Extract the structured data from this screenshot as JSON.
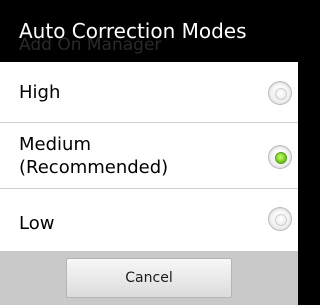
{
  "dialog": {
    "title": "Auto Correction Modes",
    "ghost_title": "Add On Manager"
  },
  "options": [
    {
      "label": "High",
      "selected": false
    },
    {
      "label": "Medium\n(Recommended)",
      "selected": true
    },
    {
      "label": "Low",
      "selected": false
    }
  ],
  "footer": {
    "cancel_label": "Cancel"
  },
  "colors": {
    "title_bar_bg": "#000000",
    "list_bg": "#ffffff",
    "footer_bg": "#c9c9c9",
    "radio_selected": "#7cd21f"
  }
}
